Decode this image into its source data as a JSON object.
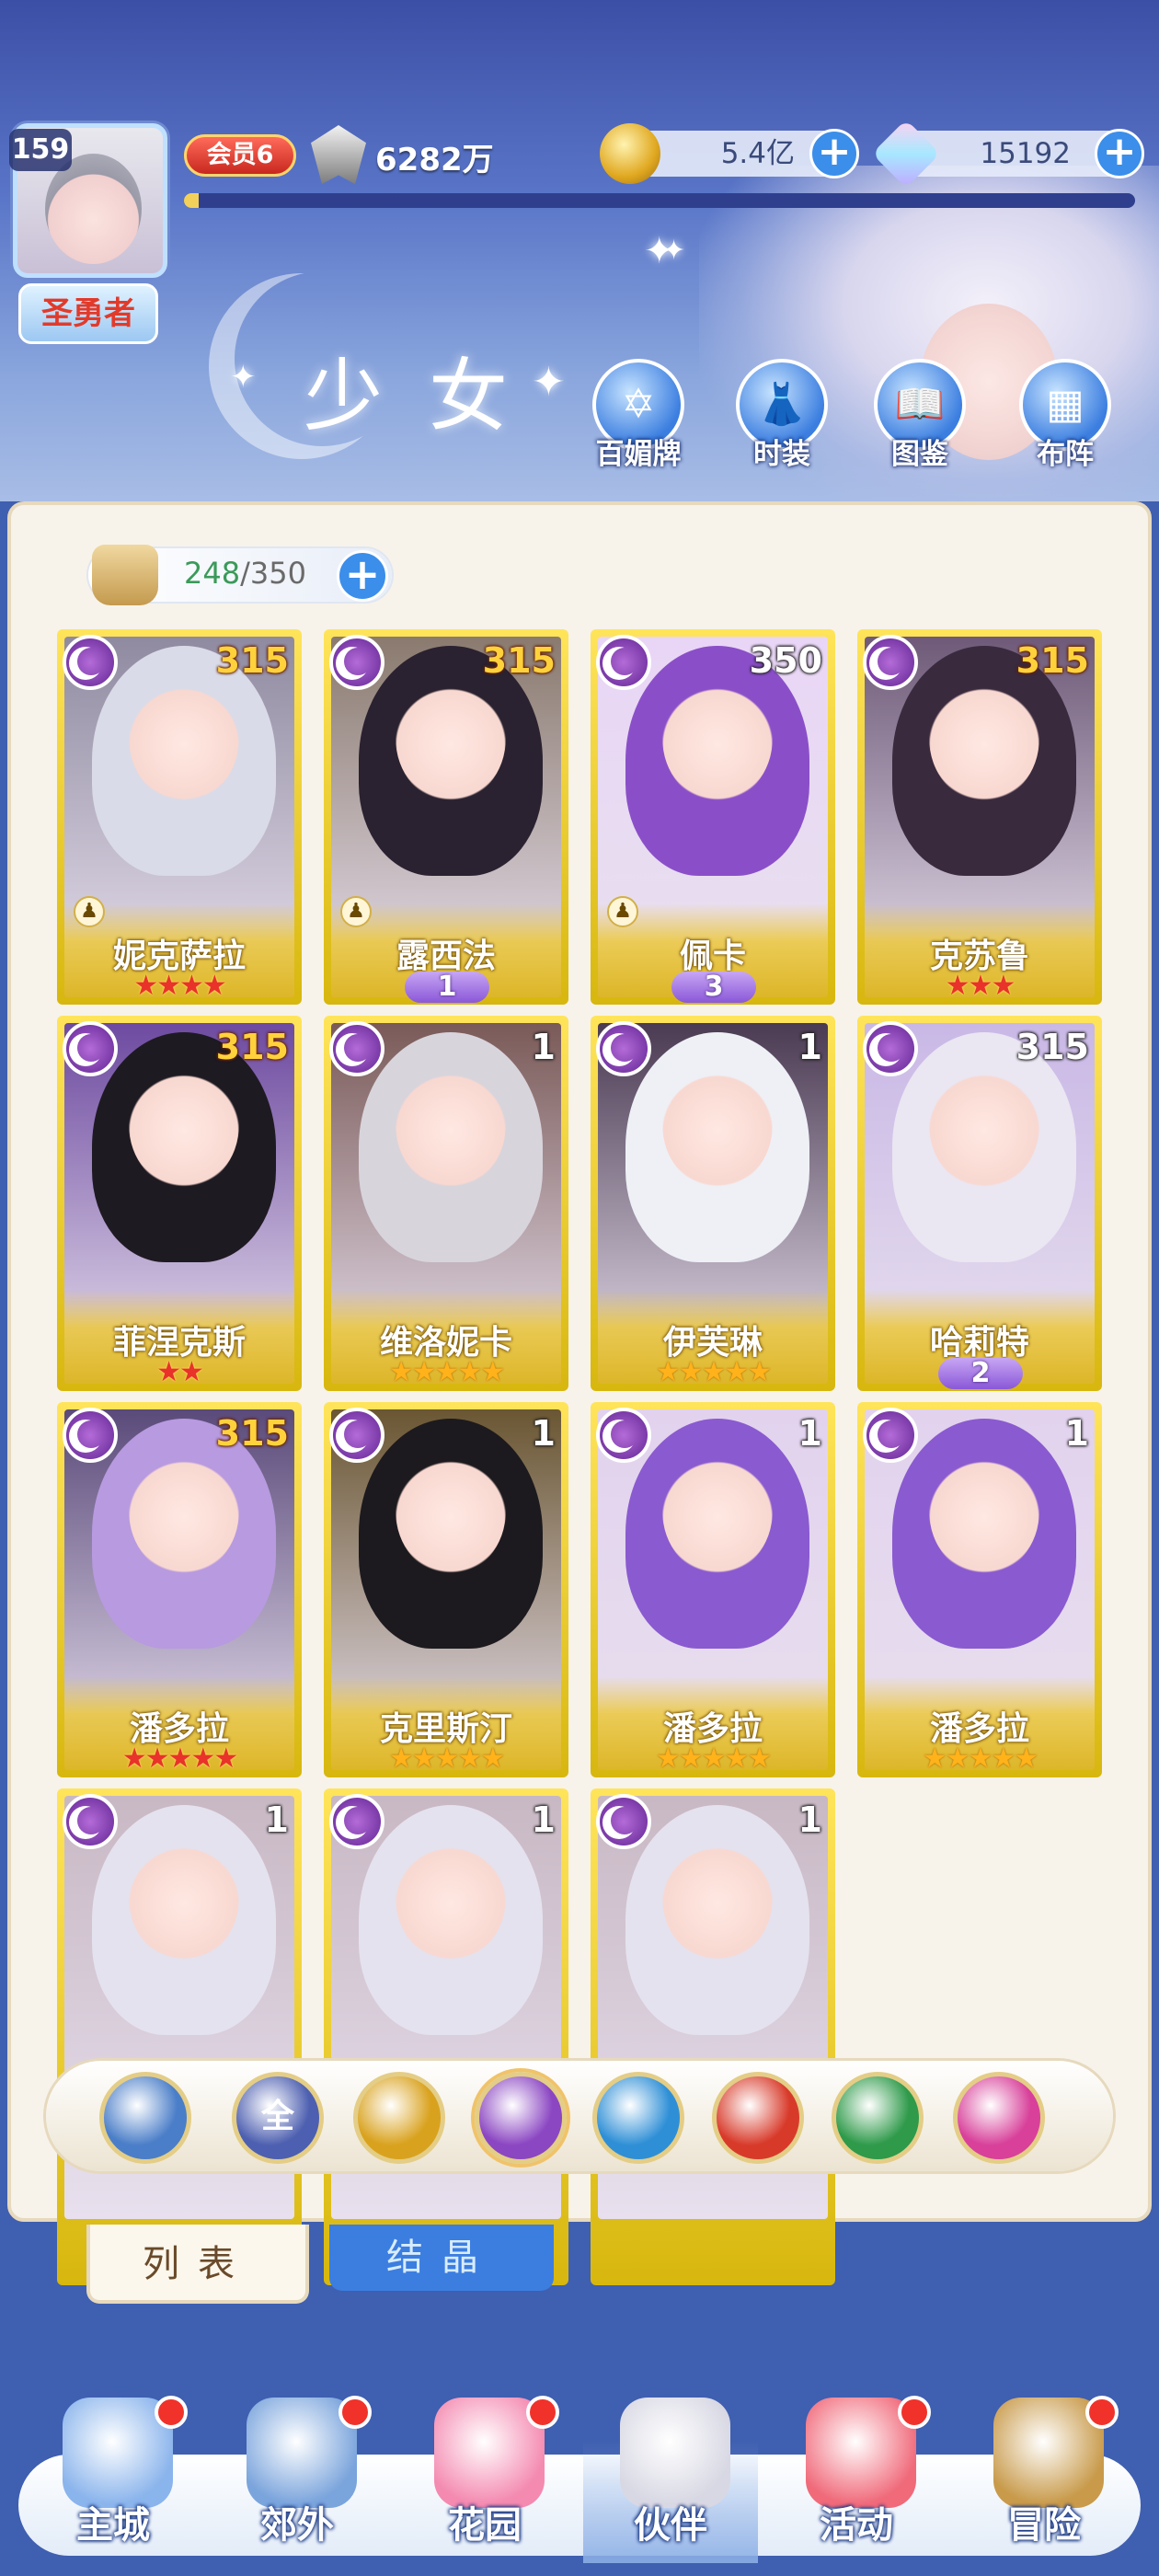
{
  "player": {
    "level": "159",
    "title": "圣勇者",
    "vip": "会员6",
    "power": "6282万",
    "exp_progress": 0.015
  },
  "resources": {
    "gold": "5.4亿",
    "gems": "15192"
  },
  "page_title": "少女",
  "top_buttons": [
    "百媚牌",
    "时装",
    "图鉴",
    "布阵"
  ],
  "capacity": {
    "current": "248",
    "max": "/350"
  },
  "cards": [
    {
      "name": "妮克萨拉",
      "level": "315",
      "level_color": "gold",
      "stars": "★★★★",
      "star_color": "red",
      "wing": "",
      "pawn": true,
      "hair": "#d9dbe8",
      "bg": "#8f8aa0"
    },
    {
      "name": "露西法",
      "level": "315",
      "level_color": "gold",
      "stars": "",
      "star_color": "red",
      "wing": "1",
      "pawn": true,
      "hair": "#2a2230",
      "bg": "#8a7a6e"
    },
    {
      "name": "佩卡",
      "level": "350",
      "level_color": "white",
      "stars": "",
      "star_color": "red",
      "wing": "3",
      "pawn": true,
      "hair": "#8a4fc8",
      "bg": "#e9d6f6"
    },
    {
      "name": "克苏鲁",
      "level": "315",
      "level_color": "gold",
      "stars": "★★★",
      "star_color": "red",
      "wing": "",
      "pawn": false,
      "hair": "#3a2a3e",
      "bg": "#6e5a78"
    },
    {
      "name": "菲涅克斯",
      "level": "315",
      "level_color": "gold",
      "stars": "★★",
      "star_color": "red",
      "wing": "",
      "pawn": false,
      "hair": "#1e1a22",
      "bg": "#6d4aa0"
    },
    {
      "name": "维洛妮卡",
      "level": "1",
      "level_color": "white",
      "stars": "★★★★★",
      "star_color": "gold",
      "wing": "",
      "pawn": false,
      "hair": "#d8d4dc",
      "bg": "#7a5a58"
    },
    {
      "name": "伊芙琳",
      "level": "1",
      "level_color": "white",
      "stars": "★★★★★",
      "star_color": "gold",
      "wing": "",
      "pawn": false,
      "hair": "#eef0f6",
      "bg": "#4a3a52"
    },
    {
      "name": "哈莉特",
      "level": "315",
      "level_color": "white",
      "stars": "",
      "star_color": "red",
      "wing": "2",
      "pawn": false,
      "hair": "#eae6f2",
      "bg": "#c9b8e6"
    },
    {
      "name": "潘多拉",
      "level": "315",
      "level_color": "gold",
      "stars": "★★★★★",
      "star_color": "red",
      "wing": "",
      "pawn": false,
      "hair": "#b89ae0",
      "bg": "#5a4a7a"
    },
    {
      "name": "克里斯汀",
      "level": "1",
      "level_color": "white",
      "stars": "★★★★★",
      "star_color": "gold",
      "wing": "",
      "pawn": false,
      "hair": "#1c1a1e",
      "bg": "#6a5632"
    },
    {
      "name": "潘多拉",
      "level": "1",
      "level_color": "white",
      "stars": "★★★★★",
      "star_color": "gold",
      "wing": "",
      "pawn": false,
      "hair": "#8a5ad0",
      "bg": "#e2d2ee"
    },
    {
      "name": "潘多拉",
      "level": "1",
      "level_color": "white",
      "stars": "★★★★★",
      "star_color": "gold",
      "wing": "",
      "pawn": false,
      "hair": "#8a5ad0",
      "bg": "#e2d2ee"
    },
    {
      "name": "",
      "level": "1",
      "level_color": "white",
      "stars": "",
      "star_color": "gold",
      "wing": "",
      "pawn": false,
      "hair": "#e4e2ee",
      "bg": "#c8b8c4"
    },
    {
      "name": "",
      "level": "1",
      "level_color": "white",
      "stars": "",
      "star_color": "gold",
      "wing": "",
      "pawn": false,
      "hair": "#e4e2ee",
      "bg": "#c8b8c4"
    },
    {
      "name": "",
      "level": "1",
      "level_color": "white",
      "stars": "",
      "star_color": "gold",
      "wing": "",
      "pawn": false,
      "hair": "#e4e2ee",
      "bg": "#c8b8c4"
    }
  ],
  "element_filters": [
    {
      "icon": "class-icon",
      "label": "",
      "color": "#4a7ec8"
    },
    {
      "icon": "all-icon",
      "label": "全",
      "color": "#4d5fb0"
    },
    {
      "icon": "sun-icon",
      "label": "",
      "color": "#d9a21e"
    },
    {
      "icon": "moon-icon",
      "label": "",
      "color": "#8b46c2"
    },
    {
      "icon": "water-icon",
      "label": "",
      "color": "#2e8fd6"
    },
    {
      "icon": "fire-icon",
      "label": "",
      "color": "#d83a2a"
    },
    {
      "icon": "wind-icon",
      "label": "",
      "color": "#2e9a4a"
    },
    {
      "icon": "chaos-icon",
      "label": "",
      "color": "#d8409a"
    }
  ],
  "tabs": {
    "list": "列表",
    "crystal": "结晶"
  },
  "nav": [
    {
      "label": "主城",
      "badge": true,
      "color": "#8ab4ec"
    },
    {
      "label": "郊外",
      "badge": true,
      "color": "#7aa4dc"
    },
    {
      "label": "花园",
      "badge": true,
      "color": "#f48ab0"
    },
    {
      "label": "伙伴",
      "badge": false,
      "color": "#d8d8e4"
    },
    {
      "label": "活动",
      "badge": true,
      "color": "#f06a7a"
    },
    {
      "label": "冒险",
      "badge": true,
      "color": "#c89a4a"
    }
  ]
}
